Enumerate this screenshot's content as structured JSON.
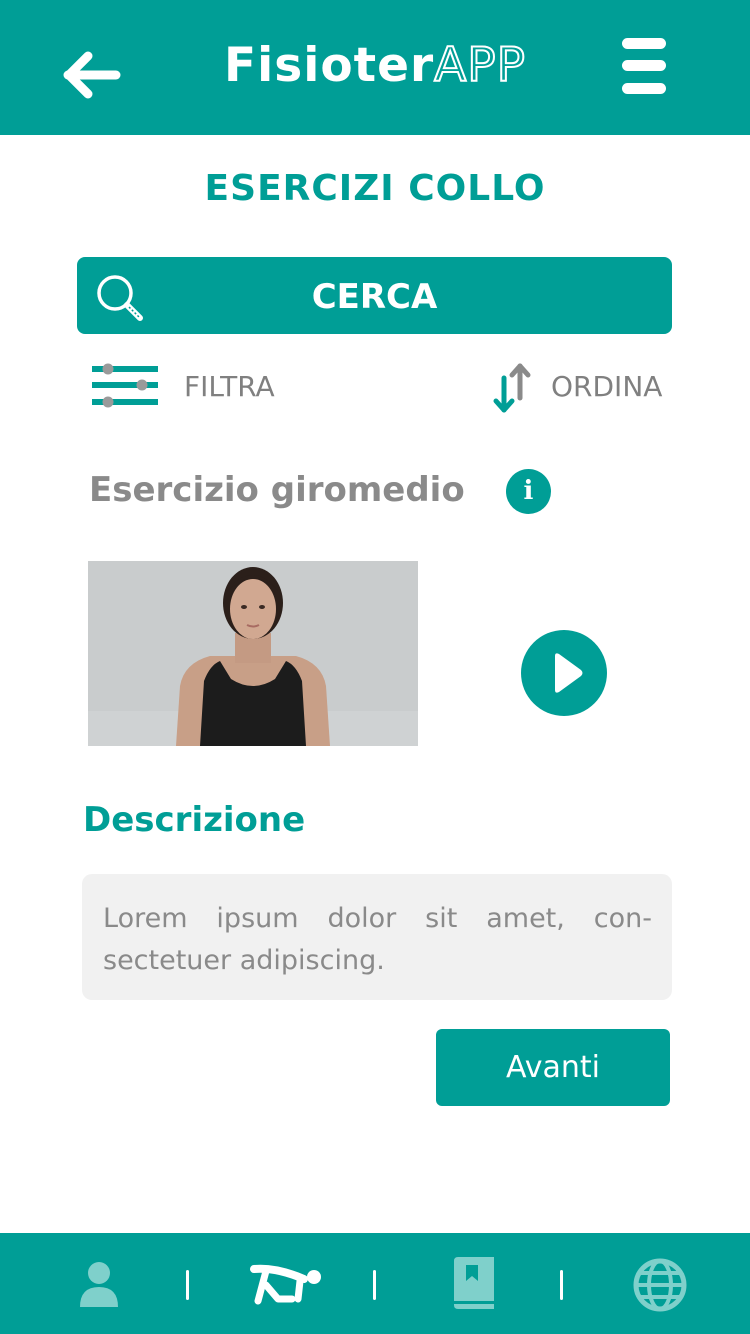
{
  "header": {
    "brand_part1": "Fisioter",
    "brand_part2": "APP",
    "back_icon": "arrow-left-icon",
    "menu_icon": "hamburger-menu-icon"
  },
  "page_title": "ESERCIZI COLLO",
  "search": {
    "label": "CERCA",
    "icon": "search-icon"
  },
  "toolbar": {
    "filter_label": "FILTRA",
    "sort_label": "ORDINA"
  },
  "exercise": {
    "title": "Esercizio giromedio",
    "info_glyph": "i"
  },
  "description": {
    "title": "Descrizione",
    "text": "Lorem ipsum dolor sit amet, con-sectetuer adipiscing."
  },
  "next_label": "Avanti",
  "bottom_nav": {
    "items": [
      {
        "icon": "user-icon",
        "active": false
      },
      {
        "icon": "exercise-icon",
        "active": true
      },
      {
        "icon": "book-icon",
        "active": false
      },
      {
        "icon": "globe-icon",
        "active": false
      }
    ]
  },
  "colors": {
    "primary": "#009e96",
    "inactive_icon": "#7fd0cb",
    "muted_text": "#8a8a8a",
    "description_bg": "#f1f1f1"
  }
}
